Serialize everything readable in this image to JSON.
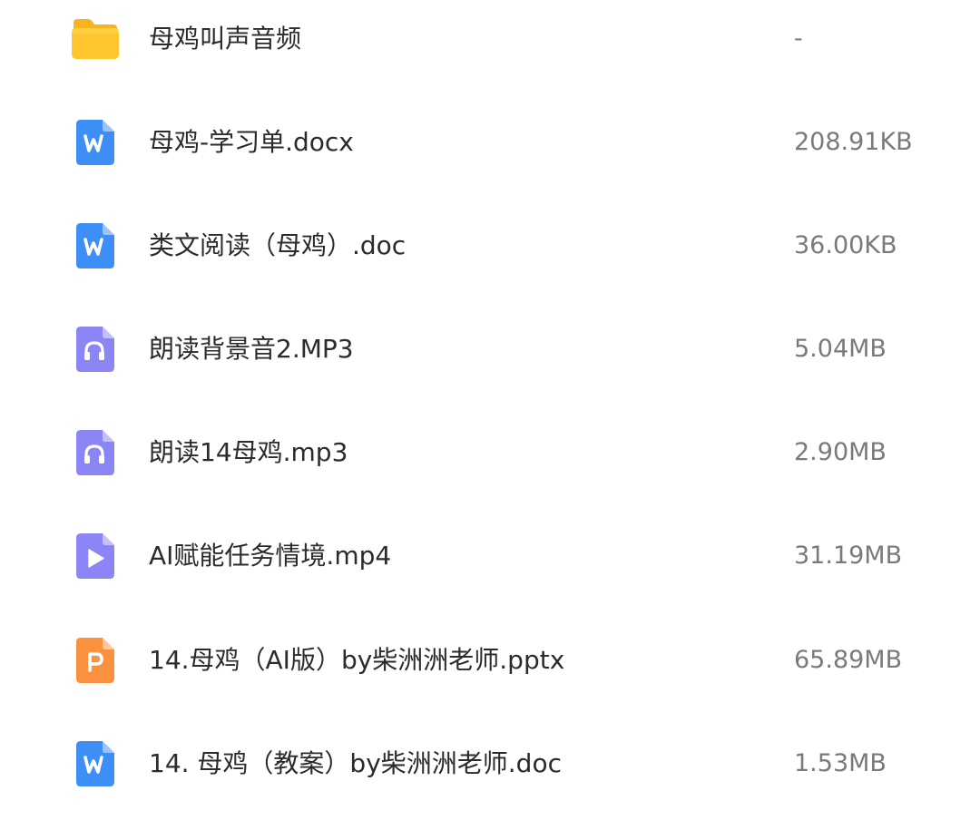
{
  "file_list": {
    "items": [
      {
        "name": "母鸡叫声音频",
        "size": "-",
        "type": "folder",
        "icon": "folder-icon",
        "color": "#FFC62F"
      },
      {
        "name": "母鸡-学习单.docx",
        "size": "208.91KB",
        "type": "word",
        "icon": "word-doc-icon",
        "color": "#3E8EF7"
      },
      {
        "name": "类文阅读（母鸡）.doc",
        "size": "36.00KB",
        "type": "word",
        "icon": "word-doc-icon",
        "color": "#3E8EF7"
      },
      {
        "name": "朗读背景音2.MP3",
        "size": "5.04MB",
        "type": "audio",
        "icon": "headphones-audio-icon",
        "color": "#8B85F5"
      },
      {
        "name": "朗读14母鸡.mp3",
        "size": "2.90MB",
        "type": "audio",
        "icon": "headphones-audio-icon",
        "color": "#8B85F5"
      },
      {
        "name": "AI赋能任务情境.mp4",
        "size": "31.19MB",
        "type": "video",
        "icon": "play-video-icon",
        "color": "#8B85F5"
      },
      {
        "name": "14.母鸡（AI版）by柴洲洲老师.pptx",
        "size": "65.89MB",
        "type": "powerpoint",
        "icon": "powerpoint-icon",
        "color": "#F9913F"
      },
      {
        "name": "14. 母鸡（教案）by柴洲洲老师.doc",
        "size": "1.53MB",
        "type": "word",
        "icon": "word-doc-icon",
        "color": "#3E8EF7"
      }
    ]
  }
}
